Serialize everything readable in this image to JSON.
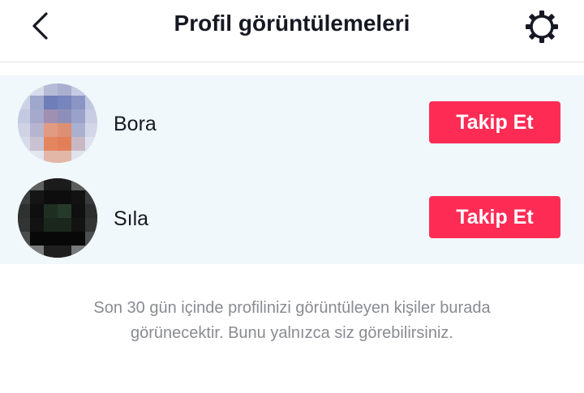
{
  "header": {
    "title": "Profil görüntülemeleri",
    "back_icon": "chevron-left-icon",
    "settings_icon": "gear-icon"
  },
  "viewers": [
    {
      "name": "Bora",
      "follow_label": "Takip Et",
      "avatar_style": "pixelated-light"
    },
    {
      "name": "Sıla",
      "follow_label": "Takip Et",
      "avatar_style": "pixelated-dark"
    }
  ],
  "notice": {
    "line1": "Son 30 gün içinde profilinizi görüntüleyen kişiler burada",
    "line2": "görünecektir. Bunu yalnızca siz görebilirsiniz."
  },
  "colors": {
    "accent": "#fe2c55",
    "list_background": "#f0f8fc",
    "text": "#161823",
    "muted_text": "#8a8b91"
  }
}
